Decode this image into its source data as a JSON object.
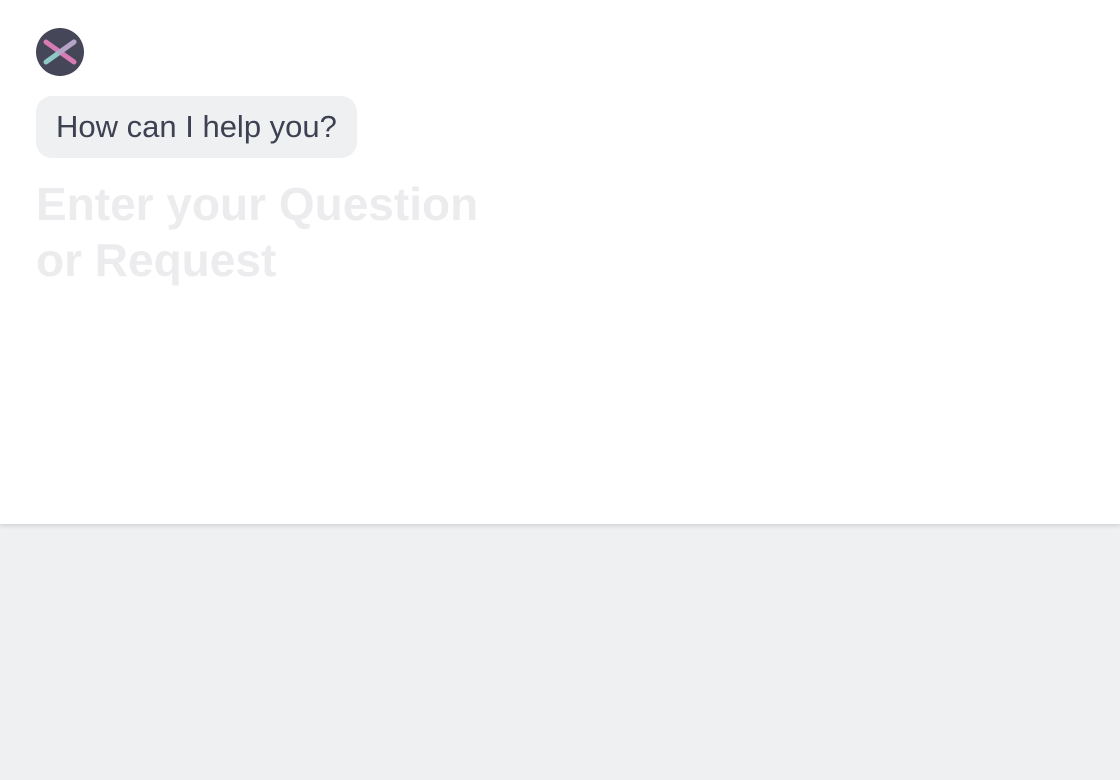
{
  "assistant": {
    "avatar_icon": "x-logo-icon",
    "avatar_bg": "#454658",
    "logo_colors": [
      "#8fc9c6",
      "#d87bb4"
    ],
    "greeting": "How can I help you?"
  },
  "input": {
    "value": "",
    "placeholder": "Enter your Question or Request"
  },
  "colors": {
    "panel_bg": "#ffffff",
    "page_bg": "#eff0f2",
    "bubble_bg": "#eff0f2",
    "text": "#3e4152",
    "placeholder": "#ececee"
  }
}
